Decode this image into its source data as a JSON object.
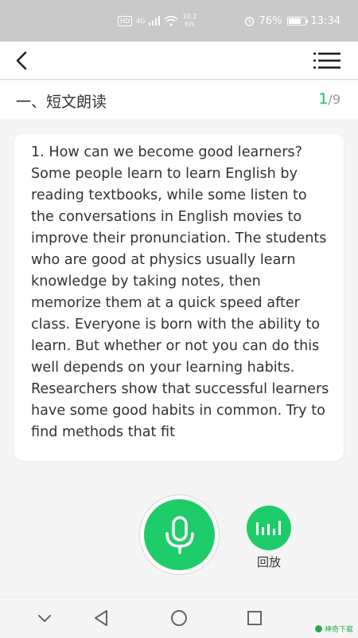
{
  "status_bar": {
    "network_badge": "HD",
    "signal_label": "4G",
    "speed_value": "10.2",
    "speed_unit": "K/s",
    "battery_percent": "76%",
    "battery_level": 0.76,
    "time": "13:34"
  },
  "toolbar": {
    "back_icon": "chevron-left-icon",
    "menu_icon": "list-menu-icon"
  },
  "section": {
    "title": "一、短文朗读",
    "current": "1",
    "separator": "/",
    "total": "9"
  },
  "passage": {
    "text": "1. How can we become good learners? Some people learn to learn English by reading textbooks, while some listen to the conversations in English movies to improve their pronunciation. The students who are good at physics usually learn knowledge by taking notes, then memorize them at a quick speed after class. Everyone is born with the ability to learn. But whether or not you can do this well depends on your learning habits. Researchers show that successful learners have some good habits in common. Try to find methods that fit"
  },
  "controls": {
    "record_icon": "microphone-icon",
    "playback_icon": "audio-bars-icon",
    "playback_label": "回放"
  },
  "nav": {
    "down": "chevron-down-icon",
    "back": "triangle-back-icon",
    "home": "circle-home-icon",
    "recents": "square-recents-icon"
  },
  "watermark": {
    "text": "神奇下载"
  },
  "colors": {
    "accent": "#1fcc6a",
    "counter_accent": "#1fbf6a",
    "status_bar": "#c9c9c9"
  }
}
